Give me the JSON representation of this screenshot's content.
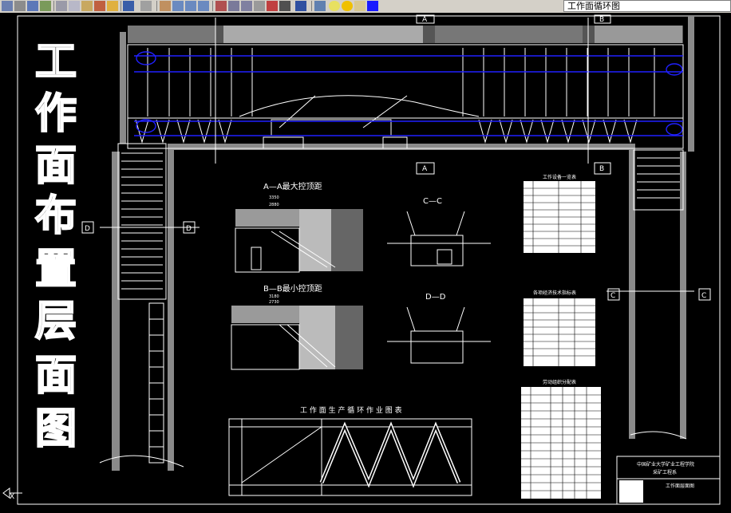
{
  "toolbar": {
    "layer_name": "工作面循环图",
    "icons": [
      "print-icon",
      "preview-icon",
      "publish-icon",
      "plot-icon",
      "cut-icon",
      "copy-icon",
      "paste-icon",
      "matchprop-icon",
      "brush-icon",
      "undo-icon",
      "redo-icon",
      "pan-icon",
      "zoom-realtime-icon",
      "zoom-window-icon",
      "zoom-previous-icon",
      "properties-icon",
      "designcenter-icon",
      "toolpalettes-icon",
      "sheetset-icon",
      "markup-icon",
      "calculator-icon",
      "help-icon",
      "layer-manager-icon",
      "bulb-icon",
      "sun-icon",
      "lock-icon",
      "color-square-icon"
    ]
  },
  "drawing": {
    "title_vertical": [
      "工",
      "作",
      "面",
      "布",
      "置",
      "层",
      "面",
      "图"
    ],
    "section_markers": {
      "A": "A",
      "B": "B",
      "C": "C",
      "D": "D"
    },
    "section_aa_title": "A—A最大控顶距",
    "section_bb_title": "B—B最小控顶距",
    "section_cc_title": "C—C",
    "section_dd_title": "D—D",
    "table_equipment_title": "工作设备一览表",
    "table_tech_title": "各项经济技术指标表",
    "table_labor_title": "劳动组织分配表",
    "cycle_chart_title": "工 作 面 生 产 循 环 作 业 图 表",
    "dim_aa_1": "3350",
    "dim_aa_2": "2880",
    "dim_bb_1": "3180",
    "dim_bb_2": "2730",
    "titleblock_line1": "中国矿业大学矿业工程学院",
    "titleblock_line2": "采矿工程系",
    "titleblock_line3": "工作面层面图"
  },
  "colors": {
    "background": "#000000",
    "line": "#ffffff",
    "blue": "#2020ff",
    "gray": "#9a9a9a",
    "toolbar": "#d4d0c8"
  }
}
